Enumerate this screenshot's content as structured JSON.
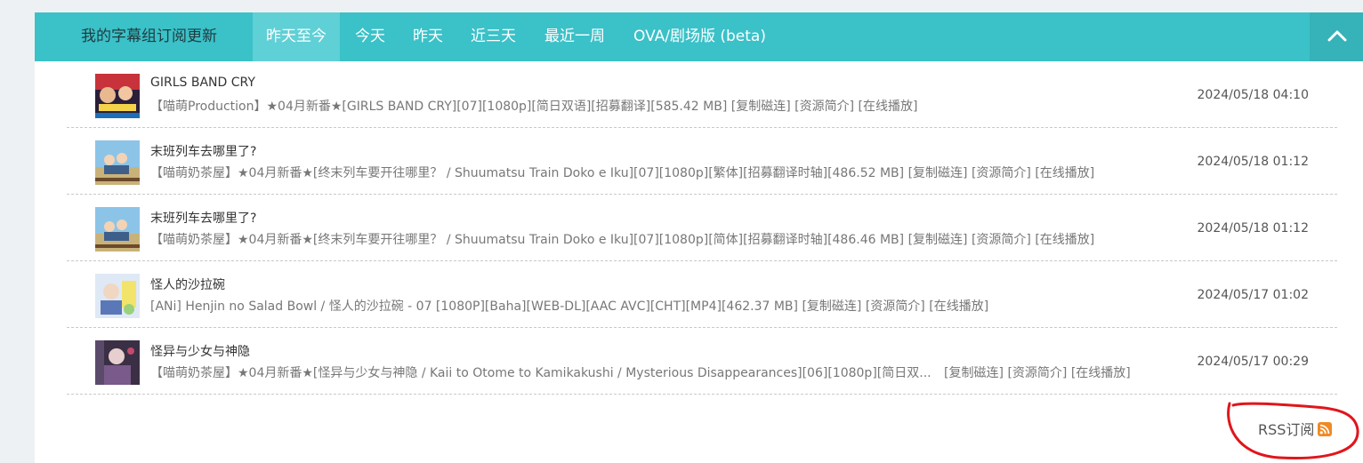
{
  "nav": {
    "title": "我的字幕组订阅更新",
    "tabs": [
      {
        "label": "昨天至今"
      },
      {
        "label": "今天"
      },
      {
        "label": "昨天"
      },
      {
        "label": "近三天"
      },
      {
        "label": "最近一周"
      },
      {
        "label": "OVA/剧场版 (beta)"
      }
    ],
    "active_tab": "昨天至今",
    "collapse_icon": "chevron-up-icon"
  },
  "colors": {
    "nav_bg": "#3bc1c8",
    "active_tab_bg": "#5fd0d6",
    "rss_orange": "#f08a24",
    "annotation_red": "#e0161b"
  },
  "items": [
    {
      "title": "GIRLS BAND CRY",
      "desc": "【喵萌Production】★04月新番★[GIRLS BAND CRY][07][1080p][简日双语][招募翻译][585.42 MB]",
      "links": [
        "[复制磁连]",
        "[资源简介]",
        "[在线播放]"
      ],
      "date": "2024/05/18 04:10"
    },
    {
      "title": "末班列车去哪里了?",
      "desc": "【喵萌奶茶屋】★04月新番★[终末列车要开往哪里？ / Shuumatsu Train Doko e Iku][07][1080p][繁体][招募翻译时轴][486.52 MB]",
      "links": [
        "[复制磁连]",
        "[资源简介]",
        "[在线播放]"
      ],
      "date": "2024/05/18 01:12"
    },
    {
      "title": "末班列车去哪里了?",
      "desc": "【喵萌奶茶屋】★04月新番★[终末列车要开往哪里？ / Shuumatsu Train Doko e Iku][07][1080p][简体][招募翻译时轴][486.46 MB]",
      "links": [
        "[复制磁连]",
        "[资源简介]",
        "[在线播放]"
      ],
      "date": "2024/05/18 01:12"
    },
    {
      "title": "怪人的沙拉碗",
      "desc": "[ANi] Henjin no Salad Bowl / 怪人的沙拉碗 - 07 [1080P][Baha][WEB-DL][AAC AVC][CHT][MP4][462.37 MB]",
      "links": [
        "[复制磁连]",
        "[资源简介]",
        "[在线播放]"
      ],
      "date": "2024/05/17 01:02"
    },
    {
      "title": "怪异与少女与神隐",
      "desc": "【喵萌奶茶屋】★04月新番★[怪异与少女与神隐 / Kaii to Otome to Kamikakushi / Mysterious Disappearances][06][1080p][简日双...",
      "links": [
        "[复制磁连]",
        "[资源简介]",
        "[在线播放]"
      ],
      "date": "2024/05/17 00:29"
    }
  ],
  "rss": {
    "label": "RSS订阅",
    "icon": "rss-icon"
  }
}
